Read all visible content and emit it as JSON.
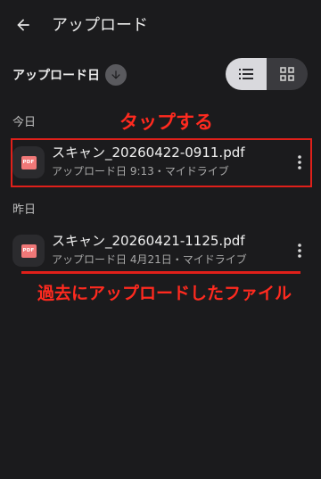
{
  "header": {
    "title": "アップロード",
    "back_icon": "arrow-left-icon"
  },
  "sort": {
    "label": "アップロード日",
    "direction_icon": "arrow-down-icon"
  },
  "view_toggle": {
    "active": "list",
    "list_icon": "list-view-icon",
    "grid_icon": "grid-view-icon"
  },
  "sections": [
    {
      "label": "今日",
      "files": [
        {
          "name": "スキャン_20260422-0911.pdf",
          "meta": "アップロード日 9:13・マイドライブ",
          "type_badge": "PDF"
        }
      ]
    },
    {
      "label": "昨日",
      "files": [
        {
          "name": "スキャン_20260421-1125.pdf",
          "meta": "アップロード日 4月21日・マイドライブ",
          "type_badge": "PDF"
        }
      ]
    }
  ],
  "annotations": {
    "tap_label": "タップする",
    "past_label": "過去にアップロードしたファイル",
    "color": "#e0201a"
  },
  "colors": {
    "background": "#1b1b1d",
    "pdf_icon": "#f07878",
    "toggle_active": "#d9d9dd"
  }
}
